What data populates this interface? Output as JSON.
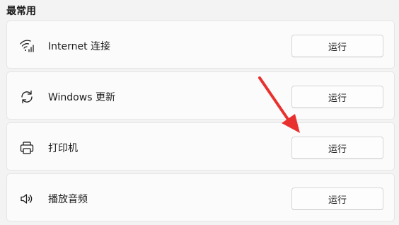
{
  "section": {
    "title": "最常用"
  },
  "items": [
    {
      "label": "Internet 连接",
      "icon": "wifi-signal-icon",
      "button": "运行"
    },
    {
      "label": "Windows 更新",
      "icon": "refresh-sync-icon",
      "button": "运行"
    },
    {
      "label": "打印机",
      "icon": "printer-icon",
      "button": "运行"
    },
    {
      "label": "播放音频",
      "icon": "speaker-volume-icon",
      "button": "运行"
    }
  ],
  "colors": {
    "background": "#f3f3f3",
    "card": "#fbfbfb",
    "annotation_arrow": "#e8312f"
  }
}
